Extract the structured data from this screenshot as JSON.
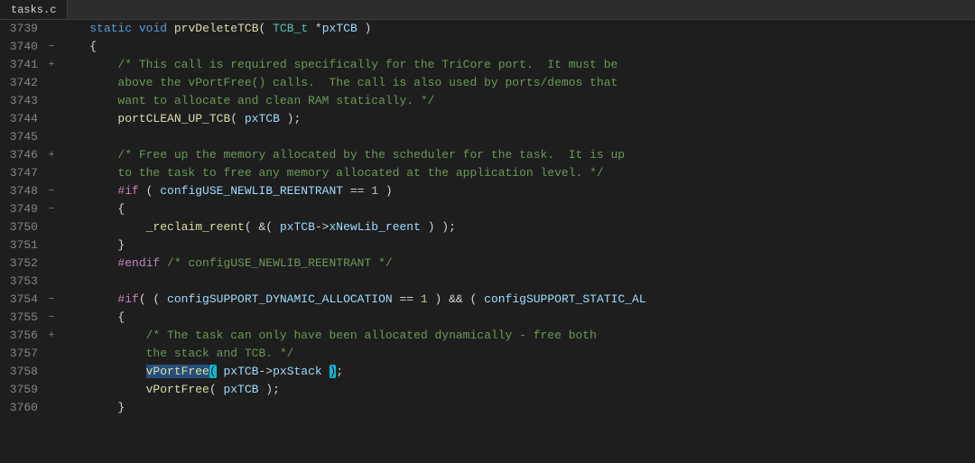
{
  "tab": {
    "label": "tasks.c"
  },
  "lines": [
    {
      "num": "3739",
      "fold": " ",
      "tokens": [
        {
          "t": "    ",
          "c": ""
        },
        {
          "t": "static",
          "c": "kw"
        },
        {
          "t": " ",
          "c": ""
        },
        {
          "t": "void",
          "c": "kw"
        },
        {
          "t": " ",
          "c": ""
        },
        {
          "t": "prvDeleteTCB",
          "c": "fn"
        },
        {
          "t": "( ",
          "c": "punct"
        },
        {
          "t": "TCB_t",
          "c": "type"
        },
        {
          "t": " *",
          "c": "punct"
        },
        {
          "t": "pxTCB",
          "c": "var"
        },
        {
          "t": " )",
          "c": "punct"
        }
      ]
    },
    {
      "num": "3740",
      "fold": "−",
      "tokens": [
        {
          "t": "    {",
          "c": "punct"
        }
      ]
    },
    {
      "num": "3741",
      "fold": "+",
      "tokens": [
        {
          "t": "        ",
          "c": ""
        },
        {
          "t": "/* This call is required specifically for the TriCore port.  It must be",
          "c": "comment"
        }
      ]
    },
    {
      "num": "3742",
      "fold": " ",
      "tokens": [
        {
          "t": "        ",
          "c": ""
        },
        {
          "t": "above the vPortFree() calls.  The call is also used by ports/demos that",
          "c": "comment"
        }
      ]
    },
    {
      "num": "3743",
      "fold": " ",
      "tokens": [
        {
          "t": "        ",
          "c": ""
        },
        {
          "t": "want to allocate and clean RAM statically. */",
          "c": "comment"
        }
      ]
    },
    {
      "num": "3744",
      "fold": " ",
      "tokens": [
        {
          "t": "        ",
          "c": ""
        },
        {
          "t": "portCLEAN_UP_TCB",
          "c": "fn"
        },
        {
          "t": "( ",
          "c": "punct"
        },
        {
          "t": "pxTCB",
          "c": "var"
        },
        {
          "t": " );",
          "c": "punct"
        }
      ]
    },
    {
      "num": "3745",
      "fold": " ",
      "tokens": []
    },
    {
      "num": "3746",
      "fold": "+",
      "tokens": [
        {
          "t": "        ",
          "c": ""
        },
        {
          "t": "/* Free up the memory allocated by the scheduler for the task.  It is up",
          "c": "comment"
        }
      ]
    },
    {
      "num": "3747",
      "fold": " ",
      "tokens": [
        {
          "t": "        ",
          "c": ""
        },
        {
          "t": "to the task to free any memory allocated at the application level. */",
          "c": "comment"
        }
      ]
    },
    {
      "num": "3748",
      "fold": "−",
      "tokens": [
        {
          "t": "        ",
          "c": ""
        },
        {
          "t": "#if",
          "c": "kw2"
        },
        {
          "t": " ( ",
          "c": ""
        },
        {
          "t": "configUSE_NEWLIB_REENTRANT",
          "c": "var"
        },
        {
          "t": " == ",
          "c": "op"
        },
        {
          "t": "1",
          "c": "num"
        },
        {
          "t": " )",
          "c": ""
        }
      ]
    },
    {
      "num": "3749",
      "fold": "−",
      "tokens": [
        {
          "t": "        {",
          "c": "punct"
        }
      ]
    },
    {
      "num": "3750",
      "fold": " ",
      "tokens": [
        {
          "t": "            ",
          "c": ""
        },
        {
          "t": "_reclaim_reent",
          "c": "fn"
        },
        {
          "t": "( &( ",
          "c": "punct"
        },
        {
          "t": "pxTCB",
          "c": "var"
        },
        {
          "t": "->",
          "c": "op"
        },
        {
          "t": "xNewLib_reent",
          "c": "var"
        },
        {
          "t": " ) );",
          "c": "punct"
        }
      ]
    },
    {
      "num": "3751",
      "fold": " ",
      "tokens": [
        {
          "t": "        }",
          "c": "punct"
        }
      ]
    },
    {
      "num": "3752",
      "fold": " ",
      "tokens": [
        {
          "t": "        ",
          "c": ""
        },
        {
          "t": "#endif",
          "c": "kw2"
        },
        {
          "t": " ",
          "c": ""
        },
        {
          "t": "/* configUSE_NEWLIB_REENTRANT */",
          "c": "comment"
        }
      ]
    },
    {
      "num": "3753",
      "fold": " ",
      "tokens": []
    },
    {
      "num": "3754",
      "fold": "−",
      "tokens": [
        {
          "t": "        ",
          "c": ""
        },
        {
          "t": "#if",
          "c": "kw2"
        },
        {
          "t": "( ( ",
          "c": ""
        },
        {
          "t": "configSUPPORT_DYNAMIC_ALLOCATION",
          "c": "var"
        },
        {
          "t": " == ",
          "c": "op"
        },
        {
          "t": "1",
          "c": "num"
        },
        {
          "t": " ) && ( ",
          "c": ""
        },
        {
          "t": "configSUPPORT_STATIC_AL",
          "c": "var"
        }
      ]
    },
    {
      "num": "3755",
      "fold": "−",
      "tokens": [
        {
          "t": "        {",
          "c": "punct"
        }
      ]
    },
    {
      "num": "3756",
      "fold": "+",
      "tokens": [
        {
          "t": "            ",
          "c": ""
        },
        {
          "t": "/* The task can only have been allocated dynamically - free both",
          "c": "comment"
        }
      ]
    },
    {
      "num": "3757",
      "fold": " ",
      "tokens": [
        {
          "t": "            ",
          "c": ""
        },
        {
          "t": "the stack and TCB. */",
          "c": "comment"
        }
      ]
    },
    {
      "num": "3758",
      "fold": " ",
      "tokens": [
        {
          "t": "            ",
          "c": ""
        },
        {
          "t": "vPortFree",
          "c": "fn-hl"
        },
        {
          "t": "(",
          "c": "paren-hl"
        },
        {
          "t": " ",
          "c": ""
        },
        {
          "t": "pxTCB",
          "c": "var"
        },
        {
          "t": "->",
          "c": "op"
        },
        {
          "t": "pxStack",
          "c": "var"
        },
        {
          "t": " ",
          "c": ""
        },
        {
          "t": ")",
          "c": "paren-hl"
        },
        {
          "t": ";",
          "c": "punct"
        }
      ]
    },
    {
      "num": "3759",
      "fold": " ",
      "tokens": [
        {
          "t": "            ",
          "c": ""
        },
        {
          "t": "vPortFree",
          "c": "fn"
        },
        {
          "t": "( ",
          "c": "punct"
        },
        {
          "t": "pxTCB",
          "c": "var"
        },
        {
          "t": " );",
          "c": "punct"
        }
      ]
    },
    {
      "num": "3760",
      "fold": " ",
      "tokens": [
        {
          "t": "        }",
          "c": "punct"
        }
      ]
    }
  ],
  "colors": {
    "tab_bg": "#1e1e1e",
    "tab_text": "#d4d4d4",
    "bg": "#1e1e1e",
    "line_num": "#858585",
    "comment": "#6a9955",
    "keyword": "#569cd6",
    "function": "#dcdcaa",
    "variable": "#9cdcfe",
    "number": "#b5cea8",
    "type": "#4ec9b0",
    "highlight_blue": "#264f78",
    "highlight_cyan": "#00bcd4"
  }
}
